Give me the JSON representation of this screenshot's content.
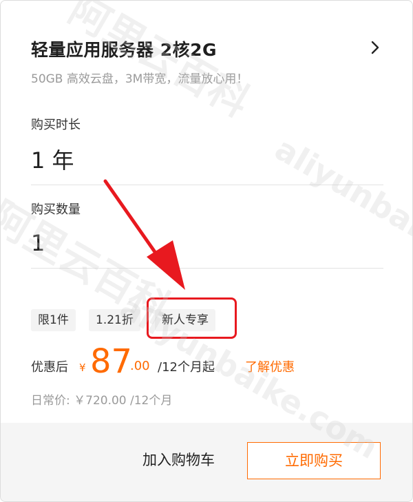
{
  "product": {
    "title": "轻量应用服务器 2核2G",
    "subtitle": "50GB 高效云盘，3M带宽，流量放心用！"
  },
  "duration": {
    "label": "购买时长",
    "value": "1 年"
  },
  "quantity": {
    "label": "购买数量",
    "value": "1"
  },
  "tags": [
    "限1件",
    "1.21折",
    "新人专享"
  ],
  "price": {
    "after_label": "优惠后",
    "currency": "¥",
    "integer": "87",
    "decimal": ".00",
    "period": "/12个月起",
    "learn_more": "了解优惠",
    "daily": "日常价: ￥720.00 /12个月"
  },
  "footer": {
    "add_to_cart": "加入购物车",
    "buy_now": "立即购买"
  },
  "watermark": {
    "cn": "阿里云百科",
    "en": "aliyunbaike.com"
  },
  "colors": {
    "accent": "#ff6a00",
    "annotation_red": "#e8191f"
  },
  "icons": {
    "chevron": "chevron-right-icon",
    "arrow": "annotation-arrow"
  }
}
